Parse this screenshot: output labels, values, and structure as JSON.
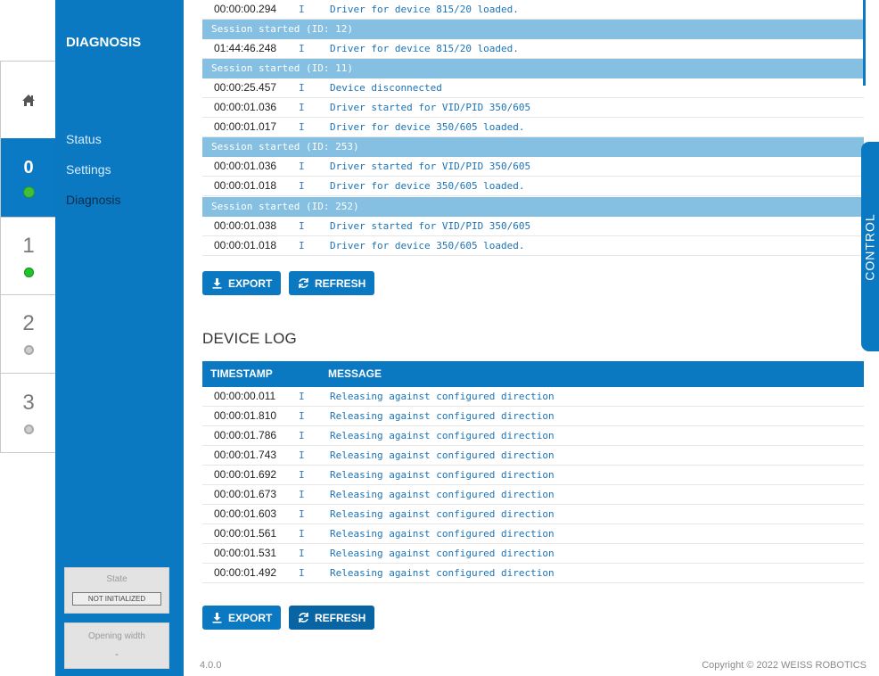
{
  "sidebar": {
    "title": "DIAGNOSIS",
    "links": [
      "Status",
      "Settings",
      "Diagnosis"
    ],
    "state_label": "State",
    "state_value": "NOT INITIALIZED",
    "width_label": "Opening width",
    "width_value": "-"
  },
  "devices": [
    {
      "number": "0",
      "status": "green",
      "active": true
    },
    {
      "number": "1",
      "status": "green",
      "active": false
    },
    {
      "number": "2",
      "status": "grey",
      "active": false
    },
    {
      "number": "3",
      "status": "grey",
      "active": false
    }
  ],
  "driver_log": {
    "rows": [
      {
        "kind": "entry",
        "ts": "00:00:00.294",
        "level": "I",
        "msg": "Driver for device 815/20 loaded."
      },
      {
        "kind": "session",
        "text": "Session started (ID: 12)"
      },
      {
        "kind": "entry",
        "ts": "01:44:46.248",
        "level": "I",
        "msg": "Driver for device 815/20 loaded."
      },
      {
        "kind": "session",
        "text": "Session started (ID: 11)"
      },
      {
        "kind": "entry",
        "ts": "00:00:25.457",
        "level": "I",
        "msg": "Device disconnected"
      },
      {
        "kind": "entry",
        "ts": "00:00:01.036",
        "level": "I",
        "msg": "Driver started for VID/PID 350/605"
      },
      {
        "kind": "entry",
        "ts": "00:00:01.017",
        "level": "I",
        "msg": "Driver for device 350/605 loaded."
      },
      {
        "kind": "session",
        "text": "Session started (ID: 253)"
      },
      {
        "kind": "entry",
        "ts": "00:00:01.036",
        "level": "I",
        "msg": "Driver started for VID/PID 350/605"
      },
      {
        "kind": "entry",
        "ts": "00:00:01.018",
        "level": "I",
        "msg": "Driver for device 350/605 loaded."
      },
      {
        "kind": "session",
        "text": "Session started (ID: 252)"
      },
      {
        "kind": "entry",
        "ts": "00:00:01.038",
        "level": "I",
        "msg": "Driver started for VID/PID 350/605"
      },
      {
        "kind": "entry",
        "ts": "00:00:01.018",
        "level": "I",
        "msg": "Driver for device 350/605 loaded."
      }
    ],
    "export_label": "EXPORT",
    "refresh_label": "REFRESH"
  },
  "device_log": {
    "title": "DEVICE LOG",
    "headers": {
      "timestamp": "TIMESTAMP",
      "message": "MESSAGE"
    },
    "rows": [
      {
        "ts": "00:00:00.011",
        "level": "I",
        "msg": "Releasing against configured direction"
      },
      {
        "ts": "00:00:01.810",
        "level": "I",
        "msg": "Releasing against configured direction"
      },
      {
        "ts": "00:00:01.786",
        "level": "I",
        "msg": "Releasing against configured direction"
      },
      {
        "ts": "00:00:01.743",
        "level": "I",
        "msg": "Releasing against configured direction"
      },
      {
        "ts": "00:00:01.692",
        "level": "I",
        "msg": "Releasing against configured direction"
      },
      {
        "ts": "00:00:01.673",
        "level": "I",
        "msg": "Releasing against configured direction"
      },
      {
        "ts": "00:00:01.603",
        "level": "I",
        "msg": "Releasing against configured direction"
      },
      {
        "ts": "00:00:01.561",
        "level": "I",
        "msg": "Releasing against configured direction"
      },
      {
        "ts": "00:00:01.531",
        "level": "I",
        "msg": "Releasing against configured direction"
      },
      {
        "ts": "00:00:01.492",
        "level": "I",
        "msg": "Releasing against configured direction"
      }
    ],
    "export_label": "EXPORT",
    "refresh_label": "REFRESH"
  },
  "control_tab": "CONTROL",
  "footer": {
    "version": "4.0.0",
    "copyright": "Copyright © 2022 WEISS ROBOTICS"
  },
  "icons": {
    "home": "home-icon",
    "download": "download-icon",
    "refresh": "refresh-icon"
  },
  "colors": {
    "primary": "#0b78c2",
    "session_row": "#85bfe2",
    "online": "#22c22e",
    "offline": "#cfcfcf"
  }
}
